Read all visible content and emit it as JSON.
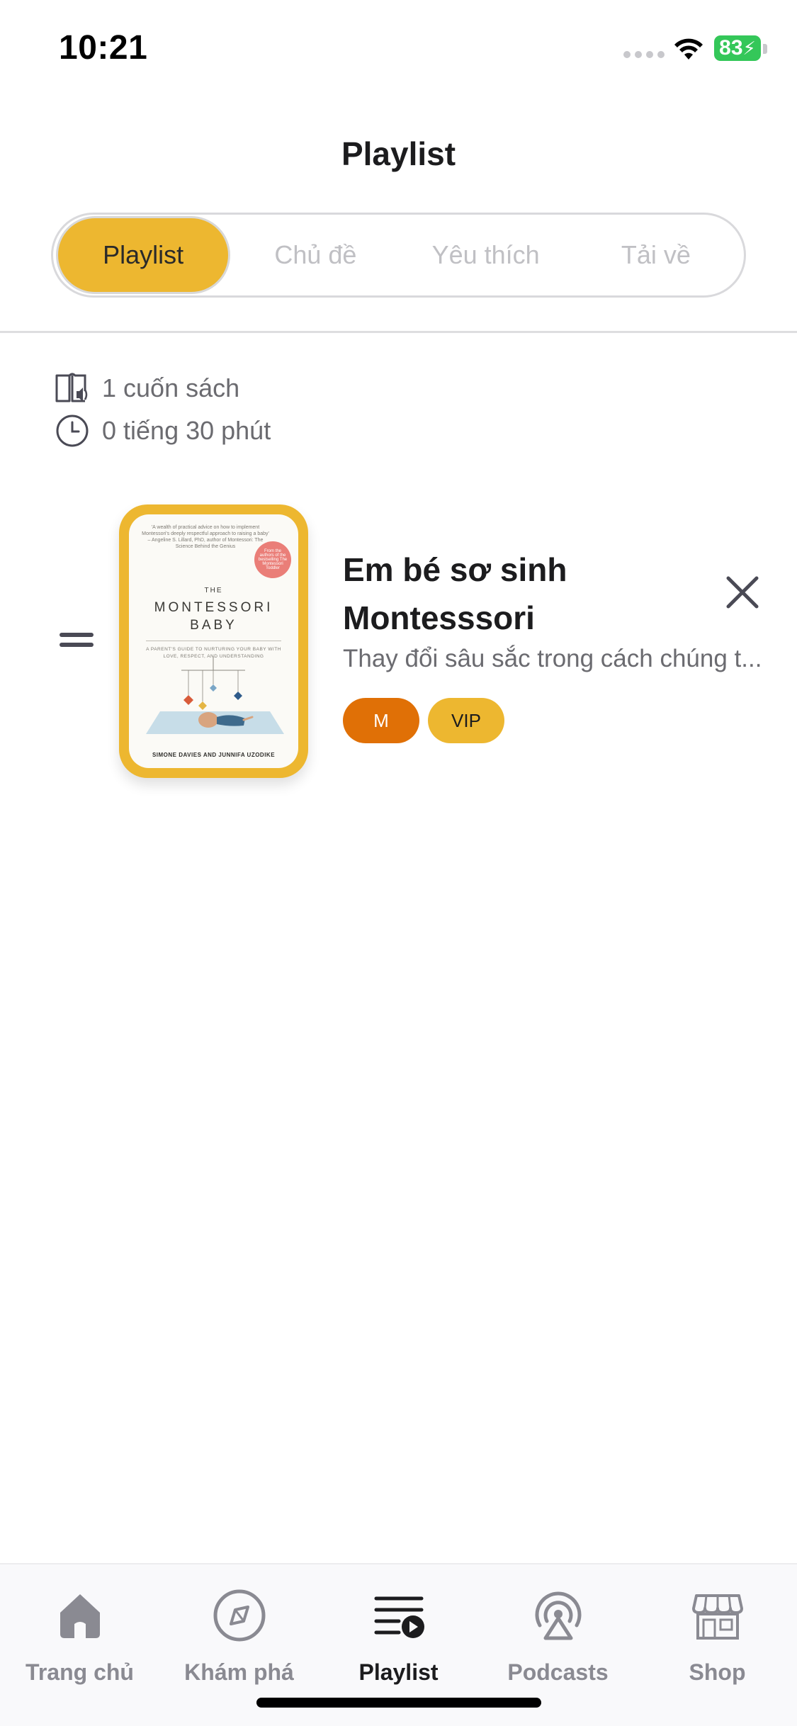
{
  "status_bar": {
    "time": "10:21",
    "battery": "83"
  },
  "header": {
    "title": "Playlist"
  },
  "segments": [
    {
      "label": "Playlist",
      "active": true
    },
    {
      "label": "Chủ đề",
      "active": false
    },
    {
      "label": "Yêu thích",
      "active": false
    },
    {
      "label": "Tải về",
      "active": false
    }
  ],
  "stats": {
    "books": "1 cuốn sách",
    "duration": "0 tiếng 30 phút"
  },
  "playlist": [
    {
      "title": "Em bé sơ sinh Montesssori",
      "description": "Thay đổi sâu sắc trong cách chúng t...",
      "tags": [
        "M",
        "VIP"
      ],
      "cover": {
        "blurb": "'A wealth of practical advice on how to implement Montessori's deeply respectful approach to raising a baby' – Angeline S. Lillard, PhD, author of Montessori: The Science Behind the Genius",
        "badge": "From the authors of the bestselling The Montessori Toddler",
        "the": "THE",
        "title_line1": "MONTESSORI",
        "title_line2": "BABY",
        "subtitle": "A PARENT'S GUIDE TO NURTURING YOUR BABY WITH LOVE, RESPECT, AND UNDERSTANDING",
        "authors": "SIMONE DAVIES AND JUNNIFA UZODIKE"
      }
    }
  ],
  "tabbar": [
    {
      "label": "Trang chủ",
      "icon": "home-icon",
      "active": false
    },
    {
      "label": "Khám phá",
      "icon": "compass-icon",
      "active": false
    },
    {
      "label": "Playlist",
      "icon": "playlist-icon",
      "active": true
    },
    {
      "label": "Podcasts",
      "icon": "podcast-icon",
      "active": false
    },
    {
      "label": "Shop",
      "icon": "shop-icon",
      "active": false
    }
  ],
  "colors": {
    "accent": "#edb730",
    "tag_m": "#e07006",
    "battery": "#34c759"
  }
}
